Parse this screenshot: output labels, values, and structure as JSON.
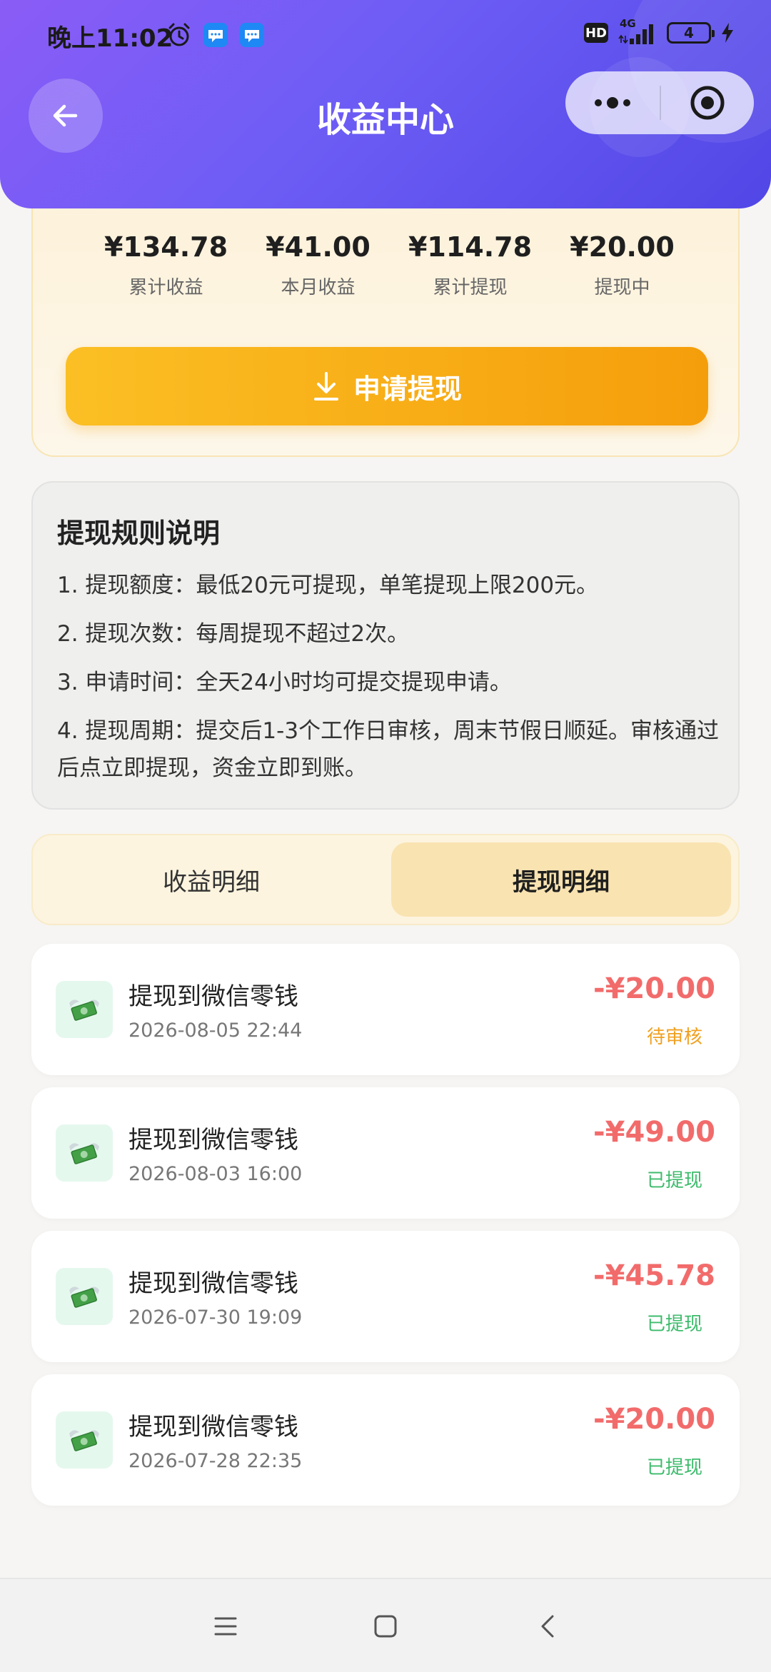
{
  "status_bar": {
    "time": "晚上11:02",
    "hd": "HD",
    "network": "4G",
    "battery": "4"
  },
  "header": {
    "title": "收益中心"
  },
  "summary": {
    "stats": [
      {
        "value": "¥134.78",
        "label": "累计收益"
      },
      {
        "value": "¥41.00",
        "label": "本月收益"
      },
      {
        "value": "¥114.78",
        "label": "累计提现"
      },
      {
        "value": "¥20.00",
        "label": "提现中"
      }
    ],
    "withdraw_button": "申请提现"
  },
  "rules": {
    "title": "提现规则说明",
    "items": [
      "1. 提现额度：最低20元可提现，单笔提现上限200元。",
      "2. 提现次数：每周提现不超过2次。",
      "3. 申请时间：全天24小时均可提交提现申请。",
      "4. 提现周期：提交后1-3个工作日审核，周末节假日顺延。审核通过后点立即提现，资金立即到账。"
    ]
  },
  "tabs": {
    "income": "收益明细",
    "withdraw": "提现明细",
    "active": "withdraw"
  },
  "records": [
    {
      "title": "提现到微信零钱",
      "time": "2026-08-05 22:44",
      "amount": "-¥20.00",
      "status": "待审核",
      "status_color": "#f0a020"
    },
    {
      "title": "提现到微信零钱",
      "time": "2026-08-03 16:00",
      "amount": "-¥49.00",
      "status": "已提现",
      "status_color": "#3dbb6c"
    },
    {
      "title": "提现到微信零钱",
      "time": "2026-07-30 19:09",
      "amount": "-¥45.78",
      "status": "已提现",
      "status_color": "#3dbb6c"
    },
    {
      "title": "提现到微信零钱",
      "time": "2026-07-28 22:35",
      "amount": "-¥20.00",
      "status": "已提现",
      "status_color": "#3dbb6c"
    }
  ],
  "icons": {
    "back": "arrow-left-icon",
    "more": "more-dots-icon",
    "close": "target-close-icon",
    "record": "money-wings-icon",
    "nav": [
      "menu-icon",
      "home-square-icon",
      "back-chevron-icon"
    ]
  },
  "colors": {
    "header_gradient_start": "#8b5cf6",
    "header_gradient_end": "#5146e6",
    "accent_orange": "#f59e0b",
    "amount_red": "#f26b6b",
    "status_pending": "#f0a020",
    "status_done": "#3dbb6c"
  }
}
